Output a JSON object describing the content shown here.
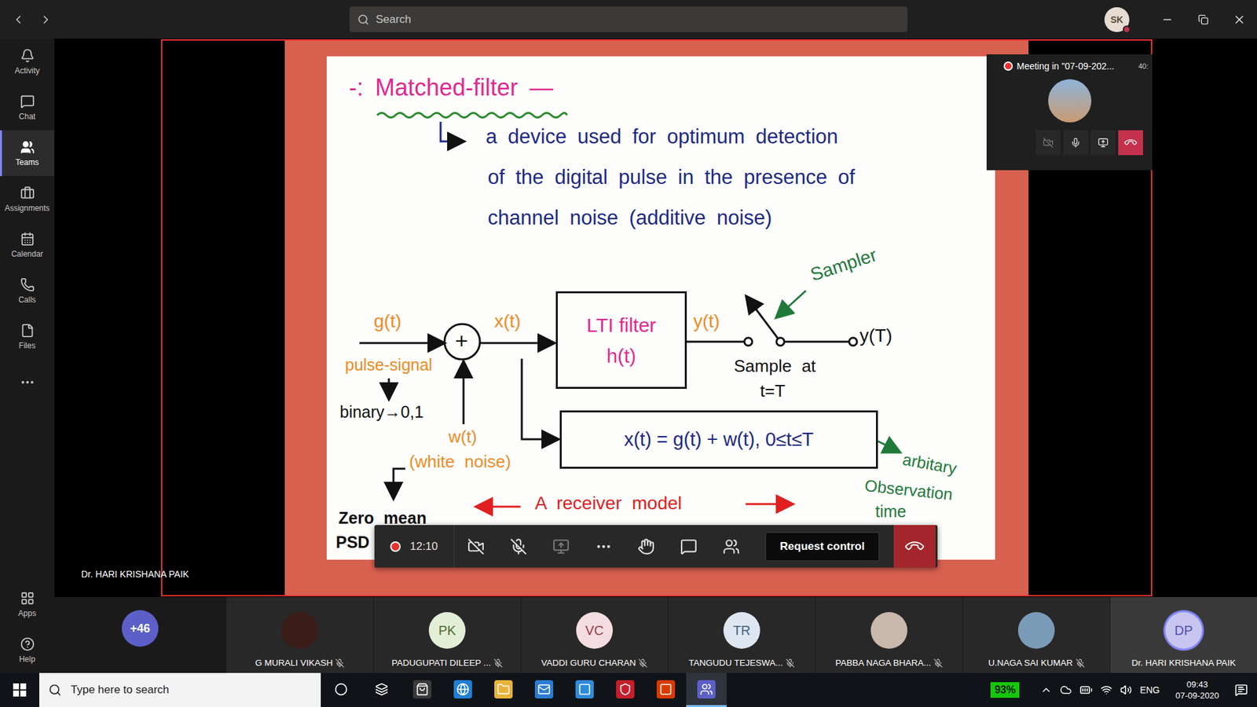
{
  "titlebar": {
    "search": {
      "placeholder": "Search"
    },
    "user": {
      "initials": "SK",
      "busy": true
    }
  },
  "rail": {
    "items": [
      {
        "label": "Activity",
        "selected": false
      },
      {
        "label": "Chat",
        "selected": false
      },
      {
        "label": "Teams",
        "selected": true
      },
      {
        "label": "Assignments",
        "selected": false
      },
      {
        "label": "Calendar",
        "selected": false
      },
      {
        "label": "Calls",
        "selected": false
      },
      {
        "label": "Files",
        "selected": false
      }
    ],
    "bottom_items": [
      {
        "label": "Apps"
      },
      {
        "label": "Help"
      }
    ]
  },
  "meeting": {
    "presenter": "Dr. HARI KRISHANA PAIK",
    "recording": true,
    "mini_window": {
      "title": "Meeting in \"07-09-202...",
      "elapsed": "40:",
      "camera_on": false
    },
    "controls": {
      "elapsed": "12:10",
      "camera_on": false,
      "mic_on": false,
      "share_enabled": false,
      "request_control": "Request control"
    }
  },
  "slide": {
    "title": "-: Matched-filter —",
    "definition_lines": [
      "a device used for optimum detection",
      "of the digital pulse in the presence of",
      "channel noise (additive noise)"
    ],
    "diagram": {
      "input": "g(t)",
      "sum": "+",
      "mixed": "x(t)",
      "filter_title": "LTI filter",
      "filter_response": "h(t)",
      "output": "y(t)",
      "sampler": "Sampler",
      "sample_at": "Sample at",
      "sample_time": "t=T",
      "sampled": "y(T)",
      "input_note": "pulse-signal",
      "input_values": "binary→0,1",
      "noise": "w(t)",
      "noise_note": "(white noise)",
      "equation": "x(t) = g(t) + w(t), 0≤t≤T",
      "observation": [
        "arbitary",
        "Observation",
        "time"
      ],
      "noise_props": [
        "Zero mean",
        "PSD"
      ],
      "caption": "A receiver model"
    }
  },
  "participants": {
    "overflow": "+46",
    "items": [
      {
        "name": "G MURALI VIKASH",
        "initials": "",
        "kind": "photo",
        "color": "#3a1d18",
        "ink": "#ffffff",
        "muted": true,
        "selected": false
      },
      {
        "name": "PADUGUPATI DILEEP ...",
        "initials": "PK",
        "kind": "initials",
        "color": "#e3eed7",
        "ink": "#4f6b2f",
        "muted": true,
        "selected": false
      },
      {
        "name": "VADDI GURU CHARAN",
        "initials": "VC",
        "kind": "initials",
        "color": "#f4dde0",
        "ink": "#9c3848",
        "muted": true,
        "selected": false
      },
      {
        "name": "TANGUDU TEJESWA...",
        "initials": "TR",
        "kind": "initials",
        "color": "#dde6f1",
        "ink": "#44607f",
        "muted": true,
        "selected": false
      },
      {
        "name": "PABBA NAGA BHARA...",
        "initials": "",
        "kind": "photo",
        "color": "#c9b8ad",
        "ink": "#ffffff",
        "muted": true,
        "selected": false
      },
      {
        "name": "U.NAGA SAI KUMAR",
        "initials": "",
        "kind": "photo",
        "color": "#7a9bb8",
        "ink": "#ffffff",
        "muted": true,
        "selected": false
      },
      {
        "name": "Dr. HARI KRISHANA PAIK",
        "initials": "DP",
        "kind": "initials",
        "color": "#c8c6f0",
        "ink": "#4f52b2",
        "muted": false,
        "selected": true
      }
    ]
  },
  "taskbar": {
    "search": {
      "placeholder": "Type here to search"
    },
    "battery": "93%",
    "language": "ENG",
    "time": "09:43",
    "date": "07-09-2020",
    "apps": [
      {
        "selected": false
      },
      {
        "selected": false
      },
      {
        "selected": false
      },
      {
        "selected": false
      },
      {
        "selected": false
      },
      {
        "selected": false
      },
      {
        "selected": false
      },
      {
        "selected": false
      },
      {
        "selected": false
      },
      {
        "selected": true
      }
    ]
  }
}
